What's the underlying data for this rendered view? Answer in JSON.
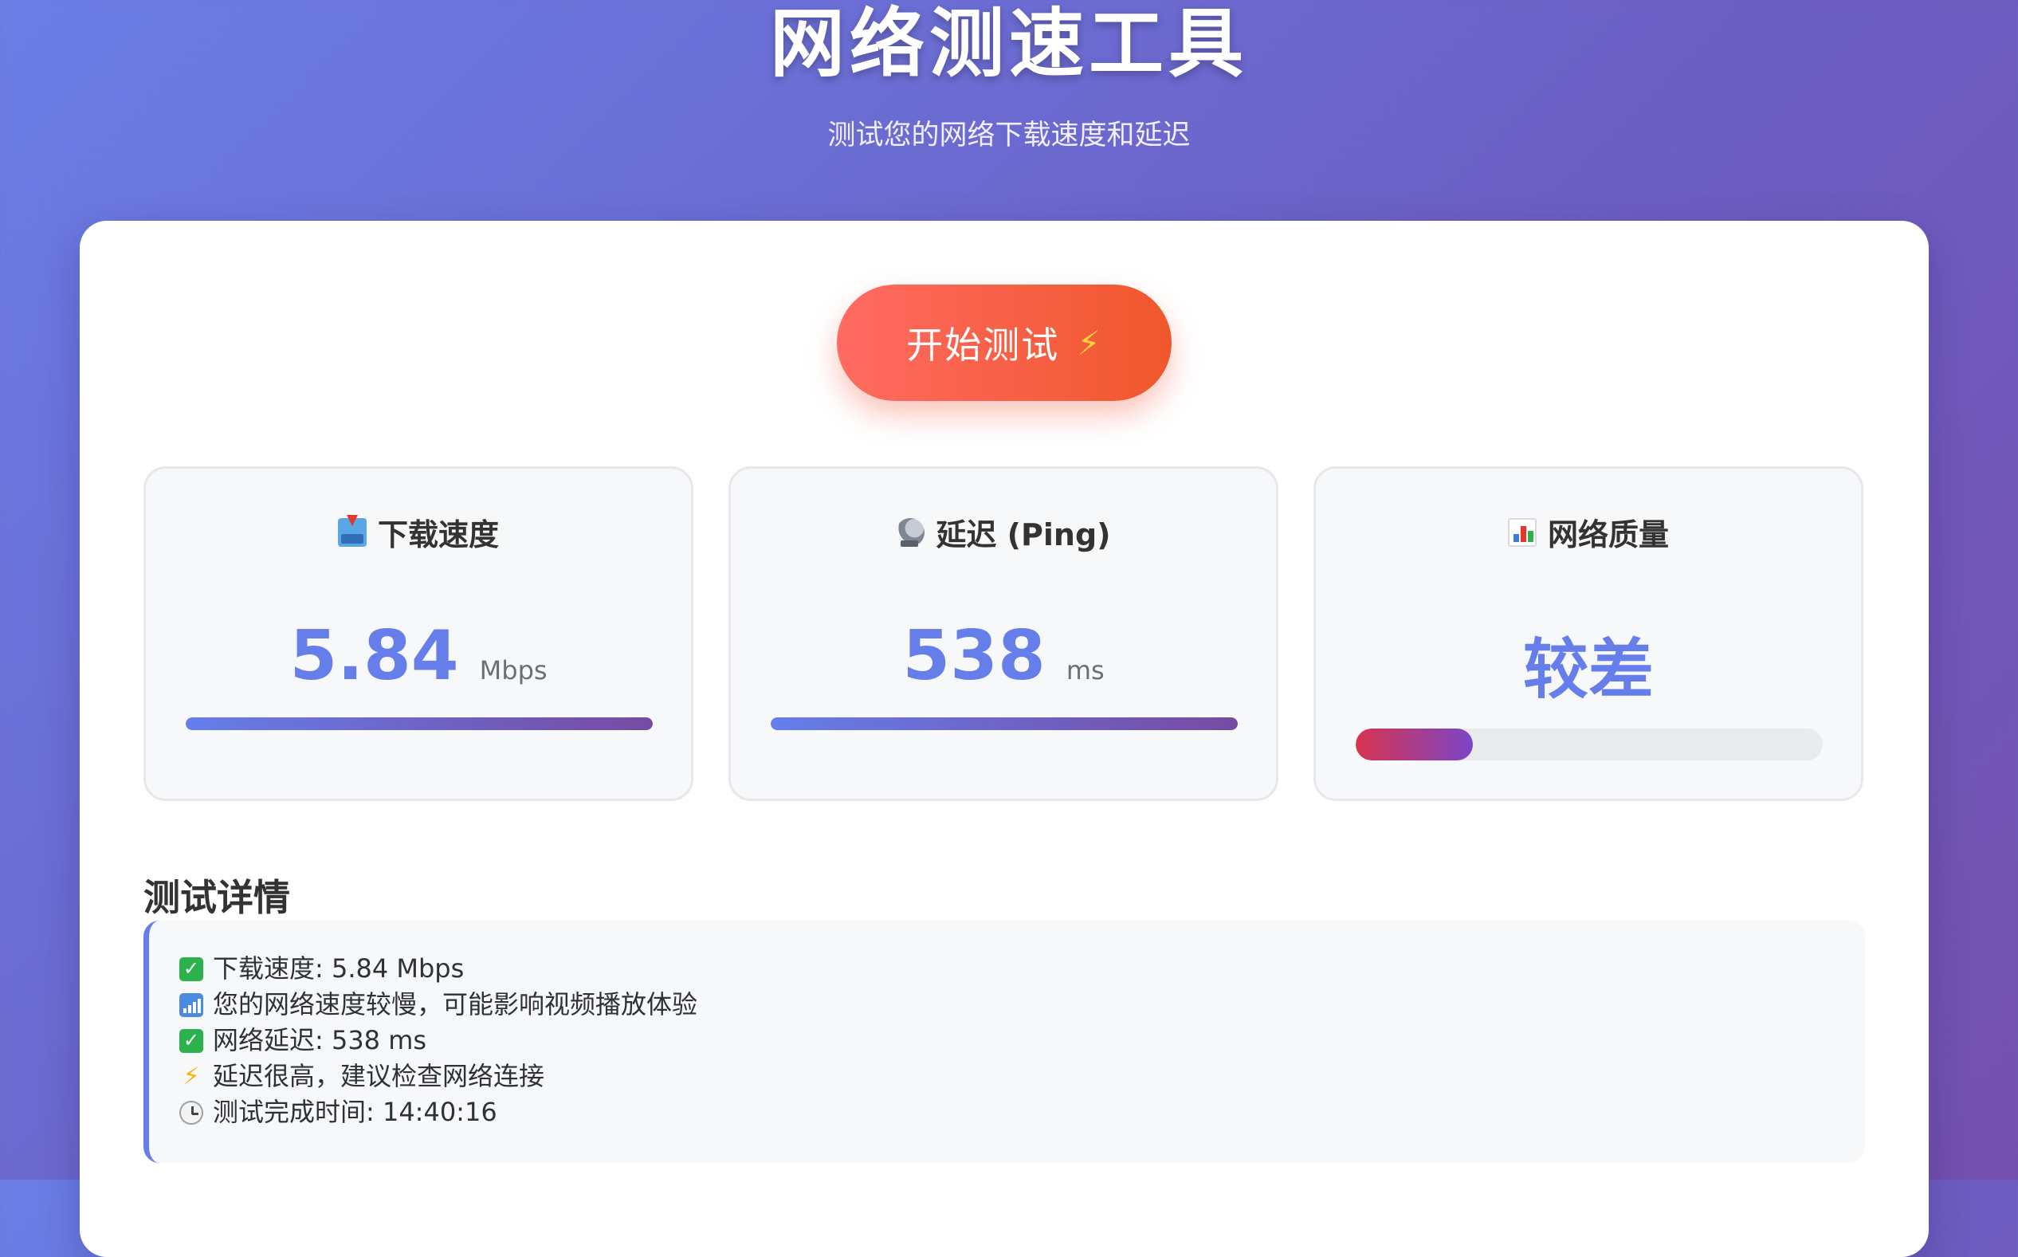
{
  "header": {
    "title": "网络测速工具",
    "subtitle": "测试您的网络下载速度和延迟"
  },
  "start_button": {
    "label": "开始测试",
    "icon": "lightning-icon"
  },
  "stats": {
    "download": {
      "title": "下载速度",
      "icon": "inbox-tray-icon",
      "value": "5.84",
      "unit": "Mbps",
      "bar_fraction": 1.0
    },
    "latency": {
      "title": "延迟 (Ping)",
      "icon": "satellite-dish-icon",
      "value": "538",
      "unit": "ms",
      "bar_fraction": 1.0
    },
    "quality": {
      "title": "网络质量",
      "icon": "bar-chart-icon",
      "value": "较差",
      "bar_fraction": 0.25
    }
  },
  "details": {
    "title": "测试详情",
    "lines": [
      {
        "icon": "check-icon",
        "text": "下载速度: 5.84 Mbps"
      },
      {
        "icon": "signal-icon",
        "text": "您的网络速度较慢，可能影响视频播放体验"
      },
      {
        "icon": "check-icon",
        "text": "网络延迟: 538 ms"
      },
      {
        "icon": "lightning-icon",
        "text": "延迟很高，建议检查网络连接"
      },
      {
        "icon": "clock-icon",
        "text": "测试完成时间: 14:40:16"
      }
    ]
  },
  "colors": {
    "accent": "#667eea",
    "accent_dark": "#764ba2",
    "button": "#f0572c"
  }
}
